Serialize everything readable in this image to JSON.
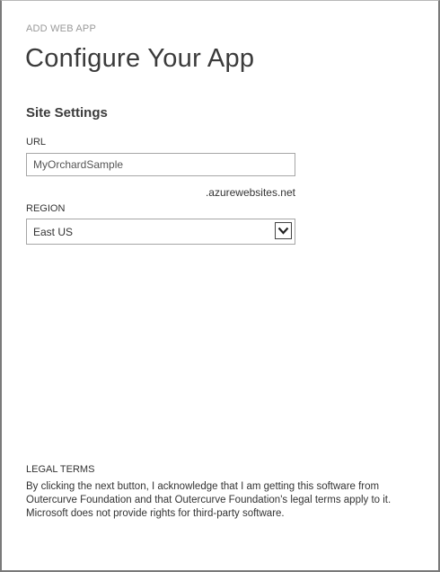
{
  "header": {
    "caption": "ADD WEB APP",
    "title": "Configure Your App"
  },
  "site_settings": {
    "heading": "Site Settings",
    "url": {
      "label": "URL",
      "value": "MyOrchardSample",
      "suffix": ".azurewebsites.net"
    },
    "region": {
      "label": "REGION",
      "selected": "East US"
    }
  },
  "legal": {
    "heading": "LEGAL TERMS",
    "text": "By clicking the next button, I acknowledge that I am getting this software from Outercurve Foundation and that Outercurve Foundation's legal terms apply to it. Microsoft does not provide rights for third-party software."
  },
  "icons": {
    "dropdown": "chevron-down-icon"
  }
}
